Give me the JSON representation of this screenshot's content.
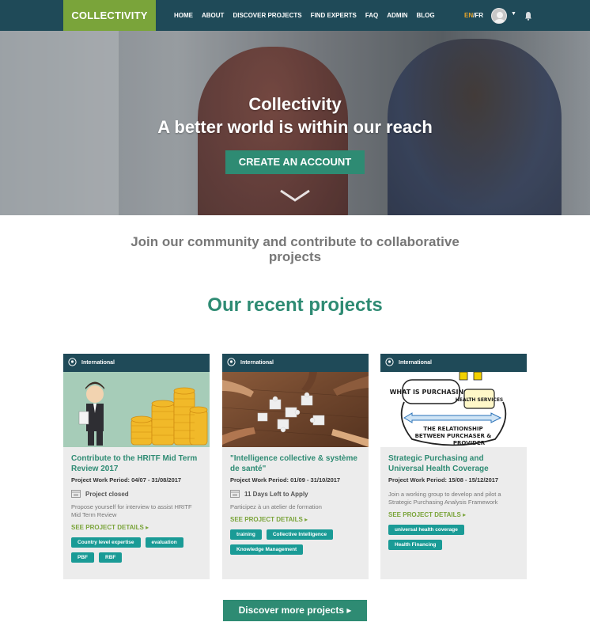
{
  "nav": {
    "logo": "COLLECTIVITY",
    "menu": [
      "HOME",
      "ABOUT",
      "DISCOVER PROJECTS",
      "FIND EXPERTS",
      "FAQ",
      "ADMIN",
      "BLOG"
    ],
    "lang_en": "EN",
    "lang_sep": "/",
    "lang_fr": "FR",
    "icons": [
      "user-avatar",
      "caret-down",
      "bell"
    ]
  },
  "hero": {
    "title": "Collectivity",
    "subtitle": "A better world is within our reach",
    "cta": "CREATE AN ACCOUNT"
  },
  "intro": "Join our community and contribute to collaborative projects",
  "section_title": "Our recent projects",
  "cards": [
    {
      "location": "International",
      "title": "Contribute to the HRITF Mid Term Review 2017",
      "period": "Project Work Period:  04/07 - 31/08/2017",
      "status": "Project closed",
      "description": "Propose yourself for interview to assist HRITF Mid Term Review",
      "details": "SEE PROJECT DETAILS",
      "tags": [
        "Country level expertise",
        "evaluation",
        "PBF",
        "RBF"
      ]
    },
    {
      "location": "International",
      "title": "\"Intelligence collective & système de santé\"",
      "period": "Project Work Period:  01/09 - 31/10/2017",
      "status": "11 Days Left to Apply",
      "description": "Participez à un atelier de formation",
      "details": "SEE PROJECT DETAILS",
      "tags": [
        "training",
        "Collective Intelligence",
        "Knowledge Management"
      ]
    },
    {
      "location": "International",
      "title": "Strategic Purchasing and Universal Health Coverage",
      "period": "Project Work Period:  15/08 - 15/12/2017",
      "status": "",
      "description": "Join a working group to develop and pilot a Strategic Purchasing Analysis Framework",
      "details": "SEE PROJECT DETAILS",
      "tags": [
        "universal health coverage",
        "Health Financing"
      ],
      "image_text": {
        "bubble1": "WHAT IS PURCHASING?",
        "bubble2": "HEALTH SERVICES",
        "line1": "THE RELATIONSHIP",
        "line2": "BETWEEN PURCHASER &",
        "line3": "PROVIDER"
      }
    }
  ],
  "more_button": "Discover more projects",
  "colors": {
    "nav": "#1f4a58",
    "logo": "#7aa43a",
    "accent": "#2e8b73",
    "tag": "#1a9b96",
    "lang_active": "#e8a62a"
  }
}
